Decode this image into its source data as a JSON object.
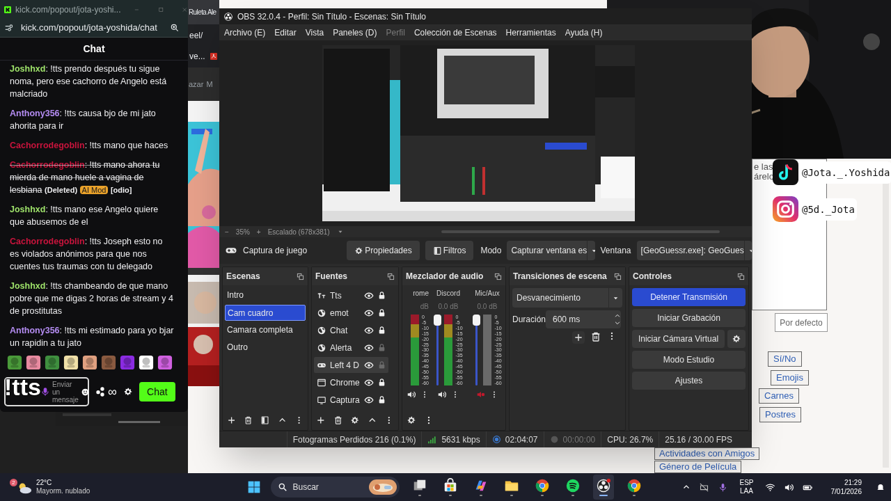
{
  "background_browser": {
    "tab": "Ruleta Ale",
    "address": "eel/",
    "bookmark": "ve...",
    "nav": [
      "azar",
      "M"
    ],
    "text_fragments": [
      "e las",
      "árelo"
    ],
    "default_button": "Por defecto",
    "category_buttons": [
      "Sí/No",
      "Emojis",
      "Carnes",
      "Postres"
    ],
    "bottom_buttons": [
      "Actividades con Amigos",
      "Género de Película"
    ]
  },
  "chat_window": {
    "title": "kick.com/popout/jota-yoshi...",
    "url": "kick.com/popout/jota-yoshida/chat",
    "heading": "Chat",
    "messages": [
      {
        "user": "Joshhxd",
        "color": "#9ee26a",
        "text": ": !tts prendo después tu sigue noma, pero ese cachorro de Angelo está malcriado",
        "deleted": false
      },
      {
        "user": "Anthony356",
        "color": "#b48cf2",
        "text": ": !tts causa bjo de mi jato ahorita para ir",
        "deleted": false
      },
      {
        "user": "Cachorrodegoblin",
        "color": "#c8143c",
        "text": ": !tts mano que haces",
        "deleted": false
      },
      {
        "user": "Cachorrodegoblin",
        "color": "#c8143c",
        "text": ": !tts mano ahora tu mierda de mano huele a vagina de lesbiana",
        "deleted": true,
        "deleted_label": "(Deleted)",
        "badge": "AI Mod",
        "tag": "[odio]"
      },
      {
        "user": "Joshhxd",
        "color": "#9ee26a",
        "text": ": !tts mano ese Angelo quiere que abusemos de el",
        "deleted": false
      },
      {
        "user": "Cachorrodegoblin",
        "color": "#c8143c",
        "text": ": !tts Joseph esto no es violados anónimos para que nos cuentes tus traumas con tu delegado",
        "deleted": false
      },
      {
        "user": "Joshhxd",
        "color": "#9ee26a",
        "text": ": !tts chambeando de que mano pobre que me digas 2 horas de stream y 4 de prostitutas",
        "deleted": false
      },
      {
        "user": "Anthony356",
        "color": "#b48cf2",
        "text": ": !tts mi estimado para yo bjar un rapidin a tu jato",
        "deleted": false
      }
    ],
    "emotes": [
      {
        "color": "#4a9a3a"
      },
      {
        "color": "#e88aa0"
      },
      {
        "color": "#3f8f3f"
      },
      {
        "color": "#f0e0a8"
      },
      {
        "color": "#e0a080"
      },
      {
        "color": "#8a5a40"
      },
      {
        "color": "#8a2be2"
      },
      {
        "color": "#ffffff"
      },
      {
        "color": "#d060e0"
      }
    ],
    "input_placeholder": "Enviar un mensaje",
    "points": "∞",
    "send_button": "Chat"
  },
  "overlay_text": "!tts",
  "socials": [
    {
      "kind": "tiktok",
      "handle": "@Jota._.Yoshida"
    },
    {
      "kind": "instagram",
      "handle": "@5d._Jota"
    }
  ],
  "obs": {
    "title": "OBS 32.0.4 - Perfil: Sin Título - Escenas: Sin Título",
    "menu": [
      {
        "label": "Archivo (E)",
        "disabled": false
      },
      {
        "label": "Editar",
        "disabled": false
      },
      {
        "label": "Vista",
        "disabled": false
      },
      {
        "label": "Paneles (D)",
        "disabled": false
      },
      {
        "label": "Perfil",
        "disabled": true
      },
      {
        "label": "Colección de Escenas",
        "disabled": false
      },
      {
        "label": "Herramientas",
        "disabled": false
      },
      {
        "label": "Ayuda (H)",
        "disabled": false
      }
    ],
    "preview_bar": {
      "zoom_out": "−",
      "zoom": "35%",
      "zoom_in": "+",
      "scaling": "Escalado (678x381)"
    },
    "source_toolbar": {
      "source": "Captura de juego",
      "properties": "Propiedades",
      "filters": "Filtros",
      "mode_label": "Modo",
      "mode": "Capturar ventana es",
      "window_label": "Ventana",
      "window": "[GeoGuessr.exe]: GeoGues"
    },
    "scenes": {
      "title": "Escenas",
      "items": [
        {
          "label": "Intro",
          "selected": false
        },
        {
          "label": "Cam cuadro",
          "selected": true
        },
        {
          "label": "Camara completa",
          "selected": false
        },
        {
          "label": "Outro",
          "selected": false
        }
      ]
    },
    "sources": {
      "title": "Fuentes",
      "items": [
        {
          "label": "Tts",
          "kind": "text",
          "visible": true,
          "locked": true,
          "selected": false
        },
        {
          "label": "emot",
          "kind": "browser",
          "visible": true,
          "locked": true,
          "selected": false
        },
        {
          "label": "Chat",
          "kind": "browser",
          "visible": true,
          "locked": true,
          "selected": false
        },
        {
          "label": "Alerta",
          "kind": "browser",
          "visible": true,
          "locked": false,
          "selected": false
        },
        {
          "label": "Left 4 D",
          "kind": "game",
          "visible": true,
          "locked": false,
          "selected": true
        },
        {
          "label": "Chrome",
          "kind": "window",
          "visible": true,
          "locked": true,
          "selected": false
        },
        {
          "label": "Captura",
          "kind": "display",
          "visible": true,
          "locked": true,
          "selected": false
        }
      ]
    },
    "mixer": {
      "title": "Mezclador de audio",
      "channels": [
        {
          "name": "rome",
          "reading": "dB",
          "muted": false,
          "scale": [
            "0",
            "-5",
            "-10",
            "-15",
            "-20",
            "-25",
            "-30",
            "-35",
            "-40",
            "-45",
            "-50",
            "-55",
            "-60"
          ]
        },
        {
          "name": "Discord",
          "reading": "0.0 dB",
          "muted": false,
          "level": 1,
          "scale": [
            "0",
            "-5",
            "-10",
            "-15",
            "-20",
            "-25",
            "-30",
            "-35",
            "-40",
            "-45",
            "-50",
            "-55",
            "-60"
          ]
        },
        {
          "name": "Mic/Aux",
          "reading": "0.0 dB",
          "muted": true,
          "level": 1,
          "scale": [
            "0",
            "-5",
            "-10",
            "-15",
            "-20",
            "-25",
            "-30",
            "-35",
            "-40",
            "-45",
            "-50",
            "-55",
            "-60"
          ]
        }
      ]
    },
    "transitions": {
      "title": "Transiciones de escena",
      "transition": "Desvanecimiento",
      "duration_label": "Duración",
      "duration": "600 ms"
    },
    "controls": {
      "title": "Controles",
      "buttons": [
        {
          "label": "Detener Transmisión",
          "active": true,
          "settings": false
        },
        {
          "label": "Iniciar Grabación",
          "active": false,
          "settings": false
        },
        {
          "label": "Iniciar Cámara Virtual",
          "active": false,
          "settings": true
        },
        {
          "label": "Modo Estudio",
          "active": false,
          "settings": false
        },
        {
          "label": "Ajustes",
          "active": false,
          "settings": false
        }
      ]
    },
    "status_bar": {
      "dropped_frames": "Fotogramas Perdidos 216 (0.1%)",
      "bitrate": "5631 kbps",
      "stream_time": "02:04:07",
      "record_time": "00:00:00",
      "cpu": "CPU: 26.7%",
      "fps": "25.16 / 30.00 FPS"
    }
  },
  "taskbar": {
    "weather": {
      "badge": "2",
      "temperature": "22°C",
      "condition": "Mayorm. nublado"
    },
    "search_placeholder": "Buscar",
    "apps": [
      {
        "kind": "taskview",
        "active": false
      },
      {
        "kind": "store",
        "active": false
      },
      {
        "kind": "copilot",
        "active": false
      },
      {
        "kind": "explorer",
        "active": false
      },
      {
        "kind": "chrome",
        "active": false
      },
      {
        "kind": "spotify",
        "active": false
      },
      {
        "kind": "obs",
        "active": true
      },
      {
        "kind": "chrome",
        "active": false
      }
    ],
    "language": "ESP",
    "layout": "LAA",
    "time": "21:29",
    "date": "7/01/2026"
  }
}
